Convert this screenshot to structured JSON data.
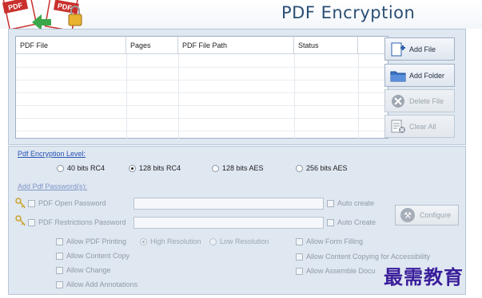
{
  "header": {
    "title": "PDF Encryption",
    "logo_icon": "pdf-lock-logo-icon",
    "logo_text_1": "PDF",
    "logo_text_2": "PDF"
  },
  "file_table": {
    "columns": [
      "PDF File",
      "Pages",
      "PDF File Path",
      "Status"
    ],
    "rows": []
  },
  "side_buttons": {
    "add_file": "Add File",
    "add_folder": "Add Folder",
    "delete_file": "Delete File",
    "clear_all": "Clear All"
  },
  "encryption": {
    "label": "Pdf Encryption Level:",
    "options": [
      "40 bits RC4",
      "128 bits RC4",
      "128 bits AES",
      "256 bits AES"
    ],
    "selected": "128 bits RC4"
  },
  "passwords": {
    "label": "Add Pdf Password(s):",
    "open_password": {
      "label": "PDF Open Password",
      "value": "",
      "auto_create": "Auto create"
    },
    "restrictions_password": {
      "label": "PDF Restrictions Password",
      "value": "",
      "auto_create": "Auto Create"
    },
    "configure": "Configure"
  },
  "permissions": {
    "allow_printing": "Allow PDF Printing",
    "high_resolution": "High Resolution",
    "low_resolution": "Low Resolution",
    "allow_content_copy": "Allow Content Copy",
    "allow_change": "Allow Change",
    "allow_annotations": "Allow Add Annotations",
    "allow_form_filling": "Allow Form Filling",
    "allow_accessibility_copy": "Allow Content Copying for Accessibility",
    "allow_assemble": "Allow Assemble Docu"
  },
  "watermark": "最需教育",
  "colors": {
    "panel": "#dfe7f1",
    "link": "#2553b3",
    "title": "#2a4f74"
  }
}
